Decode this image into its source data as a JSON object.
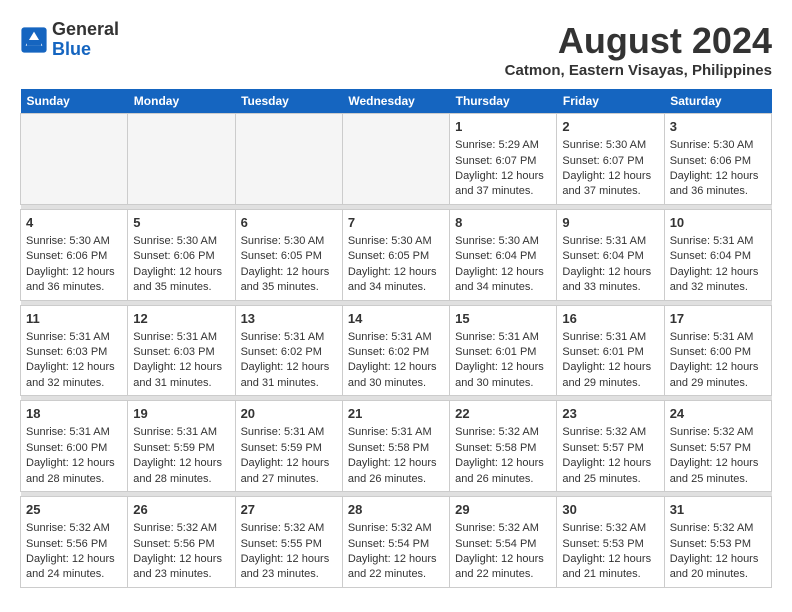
{
  "logo": {
    "line1": "General",
    "line2": "Blue"
  },
  "title": "August 2024",
  "location": "Catmon, Eastern Visayas, Philippines",
  "days_of_week": [
    "Sunday",
    "Monday",
    "Tuesday",
    "Wednesday",
    "Thursday",
    "Friday",
    "Saturday"
  ],
  "weeks": [
    [
      {
        "day": "",
        "empty": true
      },
      {
        "day": "",
        "empty": true
      },
      {
        "day": "",
        "empty": true
      },
      {
        "day": "",
        "empty": true
      },
      {
        "day": "1",
        "sunrise": "5:29 AM",
        "sunset": "6:07 PM",
        "daylight": "12 hours and 37 minutes."
      },
      {
        "day": "2",
        "sunrise": "5:30 AM",
        "sunset": "6:07 PM",
        "daylight": "12 hours and 37 minutes."
      },
      {
        "day": "3",
        "sunrise": "5:30 AM",
        "sunset": "6:06 PM",
        "daylight": "12 hours and 36 minutes."
      }
    ],
    [
      {
        "day": "4",
        "sunrise": "5:30 AM",
        "sunset": "6:06 PM",
        "daylight": "12 hours and 36 minutes."
      },
      {
        "day": "5",
        "sunrise": "5:30 AM",
        "sunset": "6:06 PM",
        "daylight": "12 hours and 35 minutes."
      },
      {
        "day": "6",
        "sunrise": "5:30 AM",
        "sunset": "6:05 PM",
        "daylight": "12 hours and 35 minutes."
      },
      {
        "day": "7",
        "sunrise": "5:30 AM",
        "sunset": "6:05 PM",
        "daylight": "12 hours and 34 minutes."
      },
      {
        "day": "8",
        "sunrise": "5:30 AM",
        "sunset": "6:04 PM",
        "daylight": "12 hours and 34 minutes."
      },
      {
        "day": "9",
        "sunrise": "5:31 AM",
        "sunset": "6:04 PM",
        "daylight": "12 hours and 33 minutes."
      },
      {
        "day": "10",
        "sunrise": "5:31 AM",
        "sunset": "6:04 PM",
        "daylight": "12 hours and 32 minutes."
      }
    ],
    [
      {
        "day": "11",
        "sunrise": "5:31 AM",
        "sunset": "6:03 PM",
        "daylight": "12 hours and 32 minutes."
      },
      {
        "day": "12",
        "sunrise": "5:31 AM",
        "sunset": "6:03 PM",
        "daylight": "12 hours and 31 minutes."
      },
      {
        "day": "13",
        "sunrise": "5:31 AM",
        "sunset": "6:02 PM",
        "daylight": "12 hours and 31 minutes."
      },
      {
        "day": "14",
        "sunrise": "5:31 AM",
        "sunset": "6:02 PM",
        "daylight": "12 hours and 30 minutes."
      },
      {
        "day": "15",
        "sunrise": "5:31 AM",
        "sunset": "6:01 PM",
        "daylight": "12 hours and 30 minutes."
      },
      {
        "day": "16",
        "sunrise": "5:31 AM",
        "sunset": "6:01 PM",
        "daylight": "12 hours and 29 minutes."
      },
      {
        "day": "17",
        "sunrise": "5:31 AM",
        "sunset": "6:00 PM",
        "daylight": "12 hours and 29 minutes."
      }
    ],
    [
      {
        "day": "18",
        "sunrise": "5:31 AM",
        "sunset": "6:00 PM",
        "daylight": "12 hours and 28 minutes."
      },
      {
        "day": "19",
        "sunrise": "5:31 AM",
        "sunset": "5:59 PM",
        "daylight": "12 hours and 28 minutes."
      },
      {
        "day": "20",
        "sunrise": "5:31 AM",
        "sunset": "5:59 PM",
        "daylight": "12 hours and 27 minutes."
      },
      {
        "day": "21",
        "sunrise": "5:31 AM",
        "sunset": "5:58 PM",
        "daylight": "12 hours and 26 minutes."
      },
      {
        "day": "22",
        "sunrise": "5:32 AM",
        "sunset": "5:58 PM",
        "daylight": "12 hours and 26 minutes."
      },
      {
        "day": "23",
        "sunrise": "5:32 AM",
        "sunset": "5:57 PM",
        "daylight": "12 hours and 25 minutes."
      },
      {
        "day": "24",
        "sunrise": "5:32 AM",
        "sunset": "5:57 PM",
        "daylight": "12 hours and 25 minutes."
      }
    ],
    [
      {
        "day": "25",
        "sunrise": "5:32 AM",
        "sunset": "5:56 PM",
        "daylight": "12 hours and 24 minutes."
      },
      {
        "day": "26",
        "sunrise": "5:32 AM",
        "sunset": "5:56 PM",
        "daylight": "12 hours and 23 minutes."
      },
      {
        "day": "27",
        "sunrise": "5:32 AM",
        "sunset": "5:55 PM",
        "daylight": "12 hours and 23 minutes."
      },
      {
        "day": "28",
        "sunrise": "5:32 AM",
        "sunset": "5:54 PM",
        "daylight": "12 hours and 22 minutes."
      },
      {
        "day": "29",
        "sunrise": "5:32 AM",
        "sunset": "5:54 PM",
        "daylight": "12 hours and 22 minutes."
      },
      {
        "day": "30",
        "sunrise": "5:32 AM",
        "sunset": "5:53 PM",
        "daylight": "12 hours and 21 minutes."
      },
      {
        "day": "31",
        "sunrise": "5:32 AM",
        "sunset": "5:53 PM",
        "daylight": "12 hours and 20 minutes."
      }
    ]
  ],
  "labels": {
    "sunrise": "Sunrise:",
    "sunset": "Sunset:",
    "daylight": "Daylight:"
  }
}
